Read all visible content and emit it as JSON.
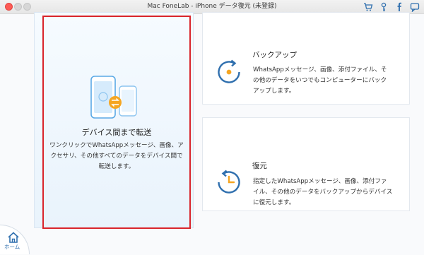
{
  "window": {
    "title": "Mac FoneLab - iPhone データ復元 (未登録)"
  },
  "toolbar_icons": [
    "cart-icon",
    "key-icon",
    "facebook-icon",
    "chat-icon"
  ],
  "transfer": {
    "title": "デバイス間まで転送",
    "desc_line1": "ワンクリックでWhatsAppメッセージ、画像、ア",
    "desc_line2": "クセサリ、その他すべてのデータをデバイス間で",
    "desc_line3": "転送します。"
  },
  "backup": {
    "title": "バックアップ",
    "desc_line1": "WhatsAppメッセージ、画像、添付ファイル、そ",
    "desc_line2": "の他のデータをいつでもコンピューターにバック",
    "desc_line3": "アップします。"
  },
  "restore": {
    "title": "復元",
    "desc_line1": "指定したWhatsAppメッセージ、画像、添付ファ",
    "desc_line2": "イル、その他のデータをバックアップからデバイス",
    "desc_line3": "に復元します。"
  },
  "home": {
    "label": "ホーム"
  },
  "colors": {
    "accent": "#2f6fae",
    "orange": "#f5a623",
    "highlight": "#d9242b"
  }
}
